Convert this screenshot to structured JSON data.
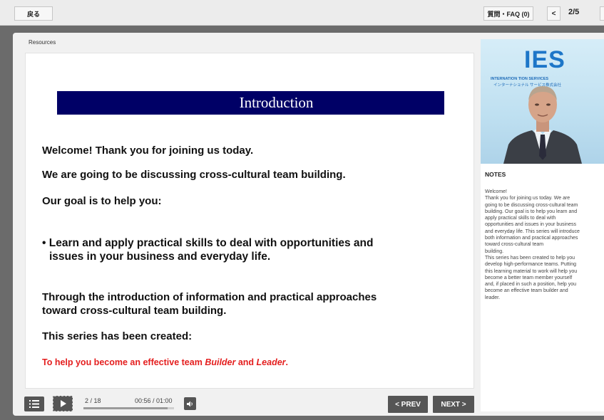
{
  "topbar": {
    "back_label": "戻る",
    "faq_label": "質問・FAQ (0)",
    "prev_page_label": "<",
    "page_counter": "2/5"
  },
  "window": {
    "resources_label": "Resources"
  },
  "slide": {
    "title": "Introduction",
    "lines": [
      "Welcome! Thank you for joining us today.",
      "We are going to be discussing cross-cultural team building.",
      "Our goal is to help you:",
      "• Learn and apply practical skills to deal with opportunities and",
      "issues in your business and everyday life.",
      "Through the introduction of information and practical approaches",
      "toward cross-cultural team building.",
      "This series has been created:"
    ],
    "red_line": {
      "part1": "To help you become an effective team ",
      "builder": "Builder",
      "and": " and ",
      "leader": "Leader",
      "period": "."
    }
  },
  "video": {
    "logo": "IES",
    "company_line1": "INTERNATION        TION SERVICES",
    "company_line2": "インターナショナル       サービス株式会社"
  },
  "notes": {
    "title": "NOTES",
    "body_lines": [
      "Welcome!",
      "Thank you for joining us today. We are",
      "going to be discussing cross-cultural team",
      "building. Our goal is to help you learn and",
      "apply practical skills to deal with",
      "opportunities and issues in your business",
      "and everyday life. This series will introduce",
      "both information and practical approaches",
      "toward cross-cultural team",
      "building.",
      "This series has been created to help you",
      "develop high-performance teams. Putting",
      "this learning material to work will help you",
      "become a better team member yourself",
      "and, if placed in such a position, help you",
      "become an effective team builder and",
      "leader."
    ]
  },
  "controls": {
    "slide_counter": "2 / 18",
    "time": "00:56 / 01:00",
    "progress": 0.93,
    "prev_label": "< PREV",
    "next_label": "NEXT >"
  },
  "colors": {
    "title_banner": "#000066",
    "red_text": "#e41e1e",
    "logo_blue": "#1d76c8"
  },
  "icons": {
    "menu": "list-icon",
    "play": "play-icon",
    "volume": "speaker-icon"
  }
}
